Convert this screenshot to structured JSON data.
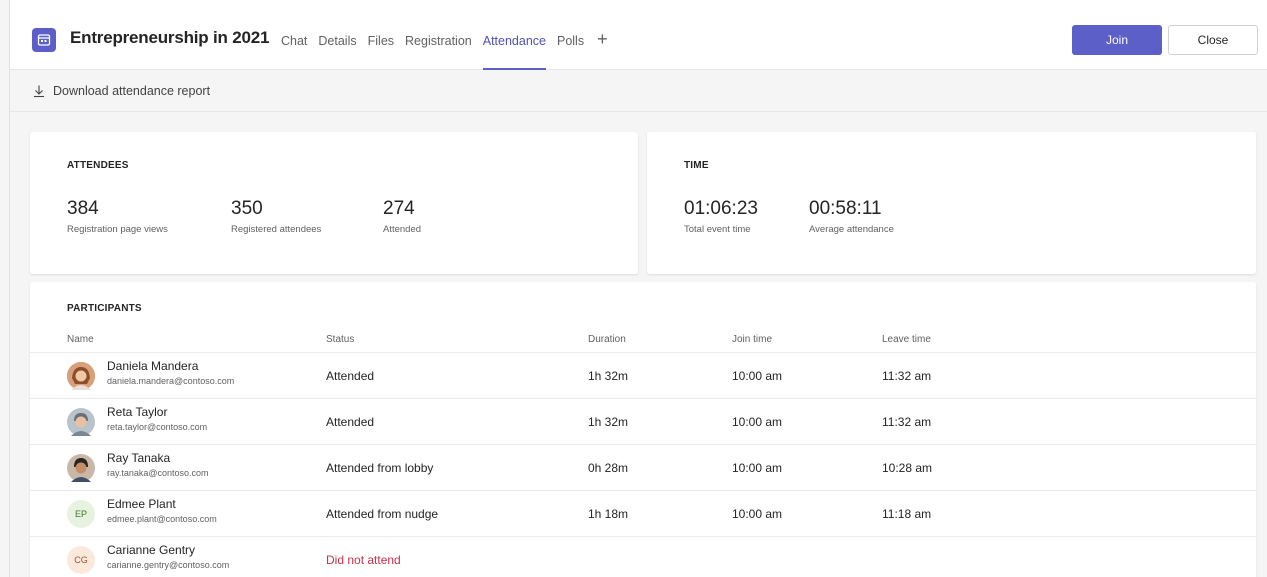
{
  "header": {
    "title": "Entrepreneurship in 2021",
    "tabs": [
      {
        "label": "Chat",
        "active": false
      },
      {
        "label": "Details",
        "active": false
      },
      {
        "label": "Files",
        "active": false
      },
      {
        "label": "Registration",
        "active": false
      },
      {
        "label": "Attendance",
        "active": true
      },
      {
        "label": "Polls",
        "active": false
      }
    ],
    "add_tab": "+",
    "join_label": "Join",
    "close_label": "Close"
  },
  "toolbar": {
    "download_label": "Download attendance report"
  },
  "attendees": {
    "label": "ATTENDEES",
    "stats": [
      {
        "value": "384",
        "label": "Registration page views"
      },
      {
        "value": "350",
        "label": "Registered attendees"
      },
      {
        "value": "274",
        "label": "Attended"
      }
    ]
  },
  "time": {
    "label": "TIME",
    "stats": [
      {
        "value": "01:06:23",
        "label": "Total event time"
      },
      {
        "value": "00:58:11",
        "label": "Average attendance"
      }
    ]
  },
  "participants": {
    "label": "PARTICIPANTS",
    "columns": [
      "Name",
      "Status",
      "Duration",
      "Join time",
      "Leave time"
    ],
    "rows": [
      {
        "name": "Daniela Mandera",
        "email": "daniela.mandera@contoso.com",
        "status": "Attended",
        "duration": "1h 32m",
        "join": "10:00 am",
        "leave": "11:32 am",
        "initials": ""
      },
      {
        "name": "Reta Taylor",
        "email": "reta.taylor@contoso.com",
        "status": "Attended",
        "duration": "1h 32m",
        "join": "10:00 am",
        "leave": "11:32 am",
        "initials": ""
      },
      {
        "name": "Ray Tanaka",
        "email": "ray.tanaka@contoso.com",
        "status": "Attended from lobby",
        "duration": "0h 28m",
        "join": "10:00 am",
        "leave": "10:28 am",
        "initials": ""
      },
      {
        "name": "Edmee Plant",
        "email": "edmee.plant@contoso.com",
        "status": "Attended from nudge",
        "duration": "1h 18m",
        "join": "10:00 am",
        "leave": "11:18 am",
        "initials": "EP"
      },
      {
        "name": "Carianne Gentry",
        "email": "carianne.gentry@contoso.com",
        "status": "Did not attend",
        "duration": "",
        "join": "",
        "leave": "",
        "initials": "CG"
      }
    ]
  },
  "colors": {
    "accent": "#5b5fc7",
    "active_tab_text": "#4f52b2",
    "did_not_attend": "#c4314b"
  }
}
